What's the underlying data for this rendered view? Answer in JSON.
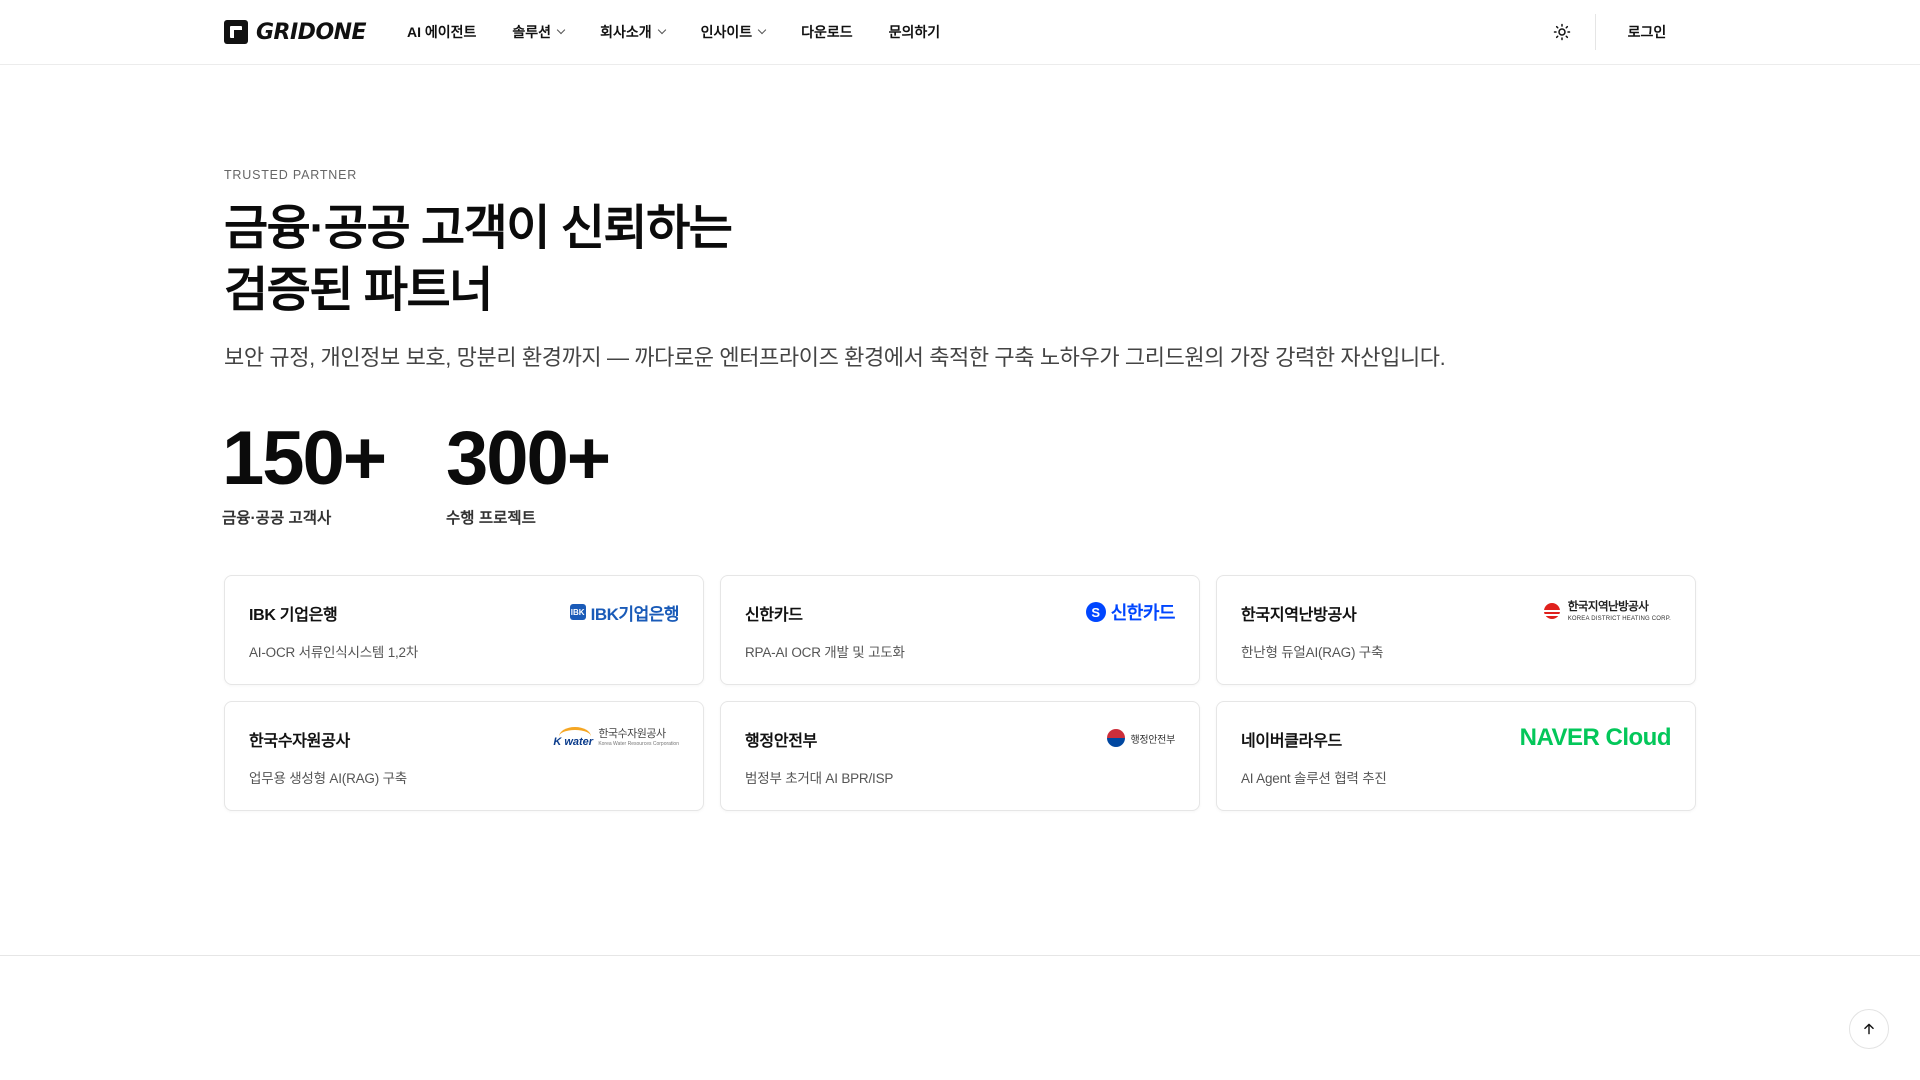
{
  "header": {
    "logo_text": "GRIDONE",
    "nav": [
      {
        "label": "AI 에이전트",
        "dropdown": false
      },
      {
        "label": "솔루션",
        "dropdown": true
      },
      {
        "label": "회사소개",
        "dropdown": true
      },
      {
        "label": "인사이트",
        "dropdown": true
      },
      {
        "label": "다운로드",
        "dropdown": false
      },
      {
        "label": "문의하기",
        "dropdown": false
      }
    ],
    "theme_icon": "sun-icon",
    "login_label": "로그인"
  },
  "hero": {
    "eyebrow": "TRUSTED PARTNER",
    "headline_line1": "금융·공공 고객이 신뢰하는",
    "headline_line2": "검증된 파트너",
    "subhead": "보안 규정, 개인정보 보호, 망분리 환경까지 — 까다로운 엔터프라이즈 환경에서 축적한 구축 노하우가 그리드원의 가장 강력한 자산입니다."
  },
  "stats": [
    {
      "value": "150+",
      "label": "금융·공공 고객사"
    },
    {
      "value": "300+",
      "label": "수행 프로젝트"
    }
  ],
  "clients": [
    {
      "name": "IBK 기업은행",
      "project": "AI-OCR 서류인식시스템 1,2차",
      "logo": {
        "badge": "IBK",
        "text": "IBK기업은행"
      }
    },
    {
      "name": "신한카드",
      "project": "RPA-AI OCR 개발 및 고도화",
      "logo": {
        "mark": "S",
        "text": "신한카드"
      }
    },
    {
      "name": "한국지역난방공사",
      "project": "한난형 듀얼AI(RAG) 구축",
      "logo": {
        "text_ko": "한국지역난방공사",
        "text_en": "KOREA DISTRICT HEATING CORP."
      }
    },
    {
      "name": "한국수자원공사",
      "project": "업무용 생성형 AI(RAG) 구축",
      "logo": {
        "mark_text": "K water",
        "text_ko": "한국수자원공사",
        "text_en": "Korea Water Resources Corporation"
      }
    },
    {
      "name": "행정안전부",
      "project": "범정부 초거대 AI BPR/ISP",
      "logo": {
        "text": "행정안전부"
      }
    },
    {
      "name": "네이버클라우드",
      "project": "AI Agent 솔루션 협력 추진",
      "logo": {
        "text": "NAVER Cloud"
      }
    }
  ],
  "colors": {
    "ibk": "#1a5bb8",
    "shinhan": "#0046ff",
    "kdhc": "#e0201c",
    "naver": "#03c75a"
  },
  "scroll_top_icon": "arrow-up-icon"
}
